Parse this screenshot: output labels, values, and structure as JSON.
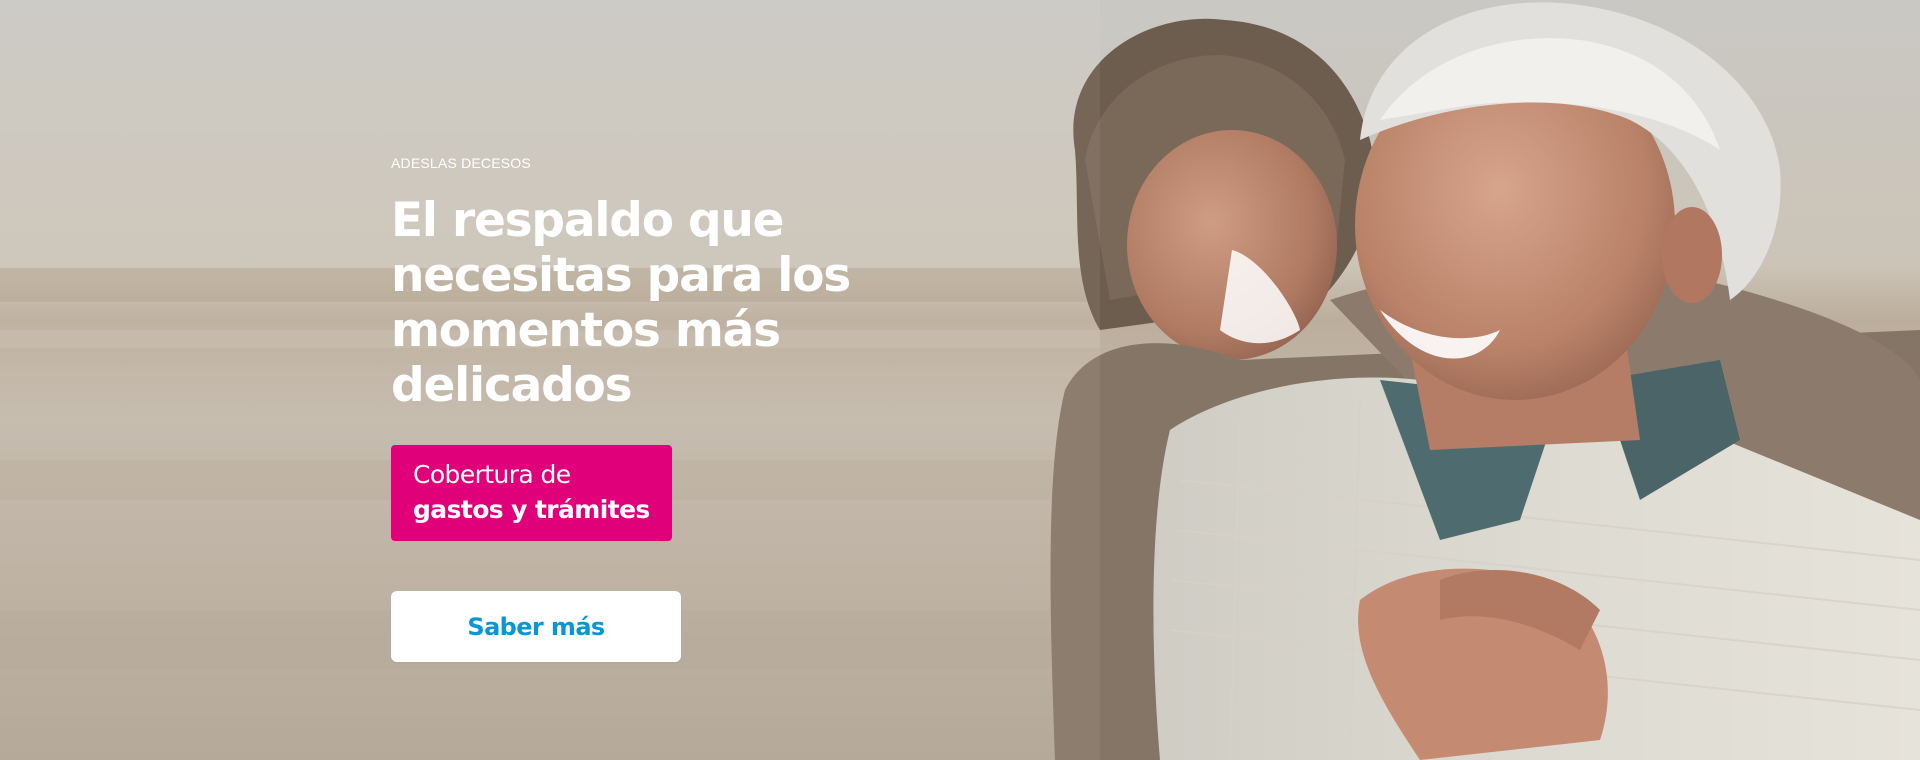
{
  "hero": {
    "eyebrow": "ADESLAS DECESOS",
    "headline_line1": "El respaldo que",
    "headline_line2": "necesitas para los",
    "headline_line3": "momentos más delicados",
    "badge_line1": "Cobertura de",
    "badge_line2": "gastos y trámites",
    "cta_label": "Saber más"
  },
  "colors": {
    "badge_background": "#e0007a",
    "cta_text": "#0a95d6",
    "cta_background": "#ffffff",
    "headline_text": "#ffffff"
  },
  "image": {
    "subject": "couple-photo"
  }
}
